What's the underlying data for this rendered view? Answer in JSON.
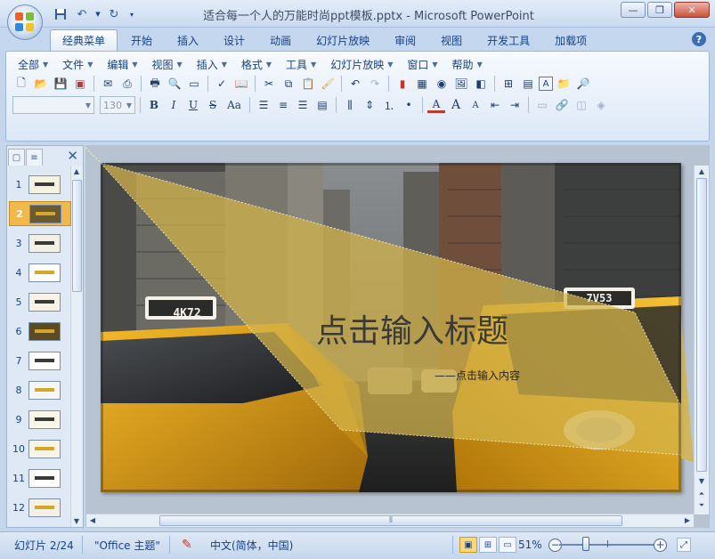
{
  "window": {
    "title": "适合每一个人的万能时尚ppt模板.pptx - Microsoft PowerPoint",
    "minimize_icon": "minimize-icon",
    "maximize_icon": "maximize-icon",
    "close_icon": "close-icon"
  },
  "quick_access": {
    "icons": [
      "save-icon",
      "undo-icon",
      "redo-icon",
      "customize-icon"
    ]
  },
  "ribbon_tabs": [
    "经典菜单",
    "开始",
    "插入",
    "设计",
    "动画",
    "幻灯片放映",
    "审阅",
    "视图",
    "开发工具",
    "加载项"
  ],
  "active_tab": "经典菜单",
  "classic_menus": [
    "全部",
    "文件",
    "编辑",
    "视图",
    "插入",
    "格式",
    "工具",
    "幻灯片放映",
    "窗口",
    "帮助"
  ],
  "toolbar": {
    "font_name_value": "",
    "font_size_value": "130",
    "bold_label": "B",
    "italic_label": "I",
    "underline_label": "U",
    "strike_label": "S",
    "case_label": "Aa",
    "font_color_label": "A",
    "grow_label": "A",
    "shrink_label": "A",
    "textbox_label": "A"
  },
  "slides_panel": {
    "slide_numbers": [
      "1",
      "2",
      "3",
      "4",
      "5",
      "6",
      "7",
      "8",
      "9",
      "10",
      "11",
      "12"
    ],
    "selected": 2
  },
  "slide": {
    "title": "点击输入标题",
    "subtitle": "——点击输入内容",
    "taxi_left_sign": "4K72",
    "taxi_right_sign": "7V53",
    "overlay_color": "#d4b44a",
    "accent_color": "#e9a91e"
  },
  "status": {
    "slide_info": "幻灯片 2/24",
    "theme": "\"Office 主题\"",
    "language": "中文(简体，中国)",
    "zoom": "51%",
    "zoom_out": "−",
    "zoom_in": "+"
  }
}
